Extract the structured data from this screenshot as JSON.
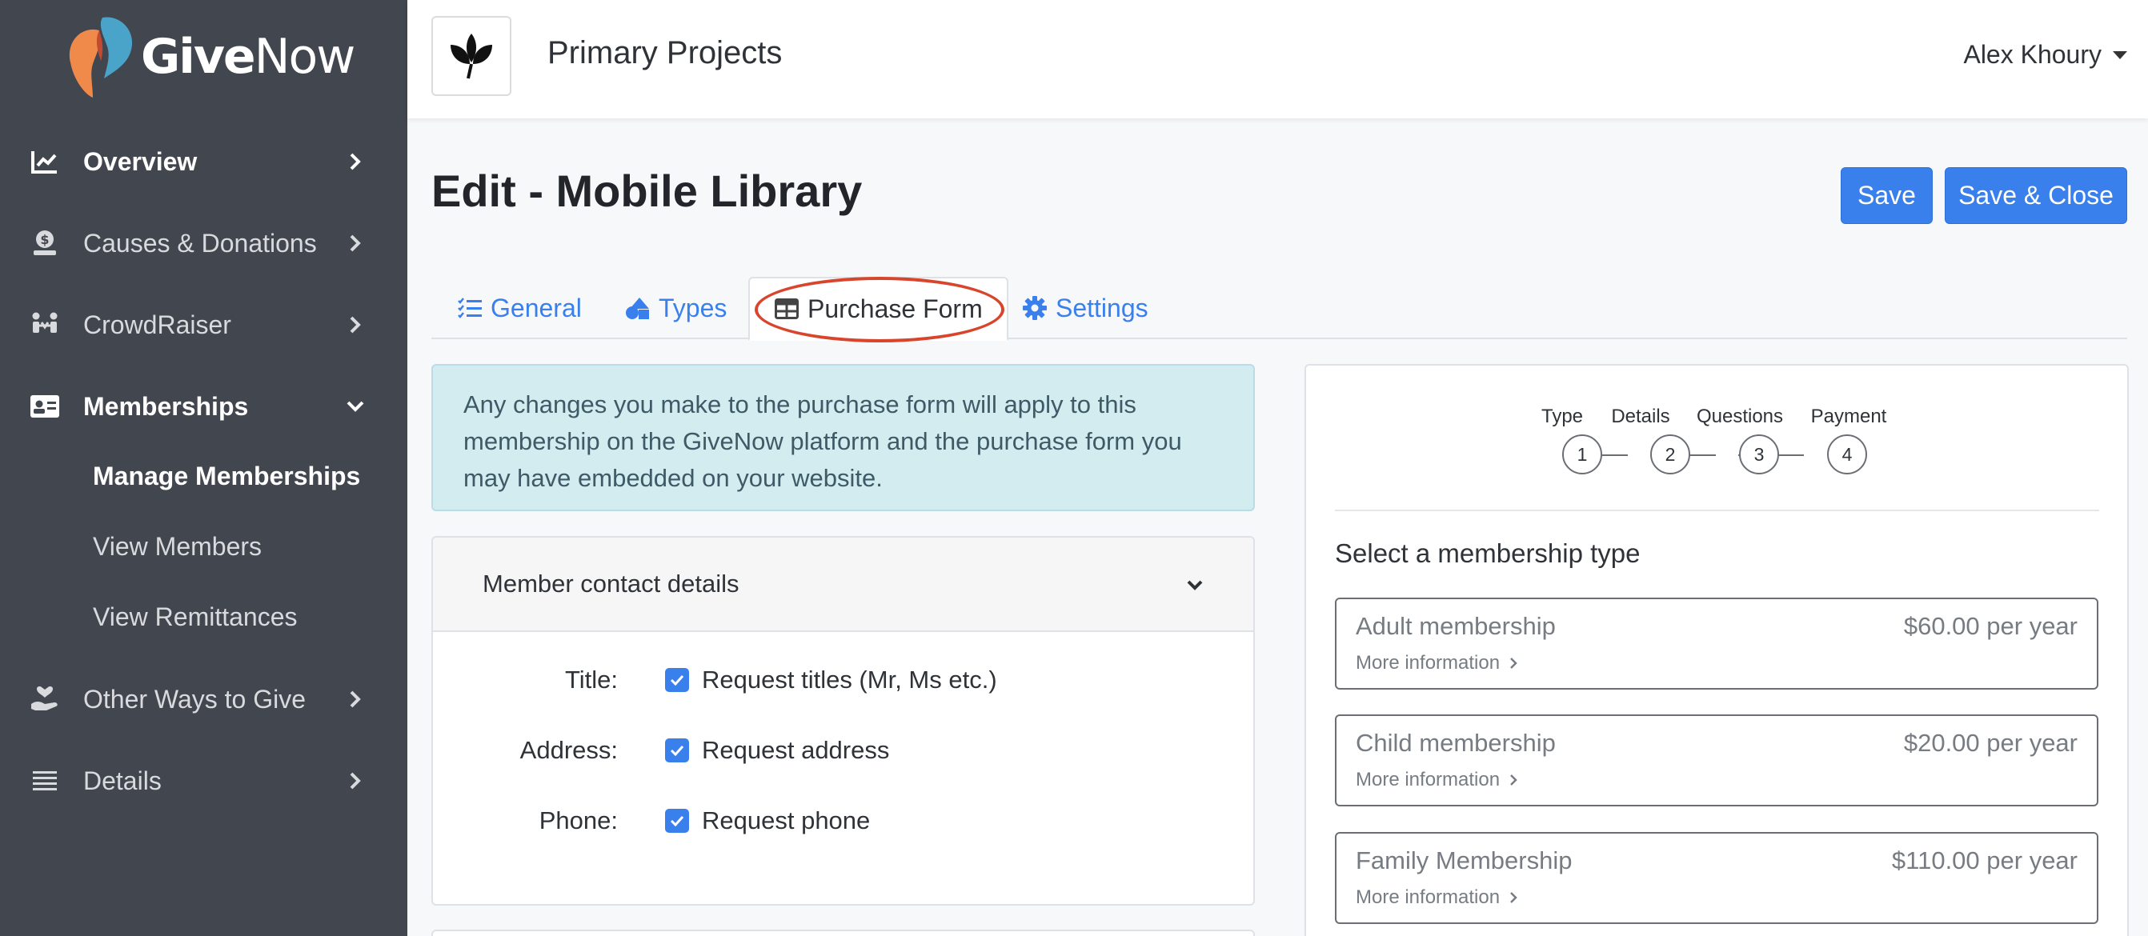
{
  "app": {
    "brand_part1": "Give",
    "brand_part2": "Now"
  },
  "sidebar": {
    "items": [
      {
        "label": "Overview",
        "icon": "chart-line-icon"
      },
      {
        "label": "Causes & Donations",
        "icon": "money-hand-icon"
      },
      {
        "label": "CrowdRaiser",
        "icon": "people-icon"
      },
      {
        "label": "Memberships",
        "icon": "id-card-icon"
      },
      {
        "label": "Other Ways to Give",
        "icon": "hand-heart-icon"
      },
      {
        "label": "Details",
        "icon": "list-icon"
      }
    ],
    "sub_items": [
      {
        "label": "Manage Memberships"
      },
      {
        "label": "View Members"
      },
      {
        "label": "View Remittances"
      }
    ]
  },
  "header": {
    "org_name": "Primary Projects",
    "user_name": "Alex Khoury"
  },
  "page": {
    "title": "Edit - Mobile Library",
    "save_label": "Save",
    "save_close_label": "Save & Close"
  },
  "tabs": [
    {
      "label": "General",
      "icon": "checklist-icon"
    },
    {
      "label": "Types",
      "icon": "shapes-icon"
    },
    {
      "label": "Purchase Form",
      "icon": "table-icon"
    },
    {
      "label": "Settings",
      "icon": "gear-icon"
    }
  ],
  "info_message": "Any changes you make to the purchase form will apply to this membership on the GiveNow platform and the purchase form you may have embedded on your website.",
  "contact_card": {
    "title": "Member contact details",
    "fields": [
      {
        "label": "Title:",
        "text": "Request titles (Mr, Ms etc.)",
        "checked": true
      },
      {
        "label": "Address:",
        "text": "Request address",
        "checked": true
      },
      {
        "label": "Phone:",
        "text": "Request phone",
        "checked": true
      }
    ]
  },
  "preview": {
    "steps": [
      {
        "label": "Type",
        "number": "1"
      },
      {
        "label": "Details",
        "number": "2"
      },
      {
        "label": "Questions",
        "number": "3"
      },
      {
        "label": "Payment",
        "number": "4"
      }
    ],
    "section_title": "Select a membership type",
    "options": [
      {
        "name": "Adult membership",
        "price": "$60.00 per year",
        "more": "More information"
      },
      {
        "name": "Child membership",
        "price": "$20.00 per year",
        "more": "More information"
      },
      {
        "name": "Family Membership",
        "price": "$110.00 per year",
        "more": "More information"
      }
    ]
  },
  "colors": {
    "sidebar_bg": "#42464f",
    "accent": "#3a80ec",
    "annotation": "#d9452c",
    "info_bg": "#d3ecf0"
  }
}
